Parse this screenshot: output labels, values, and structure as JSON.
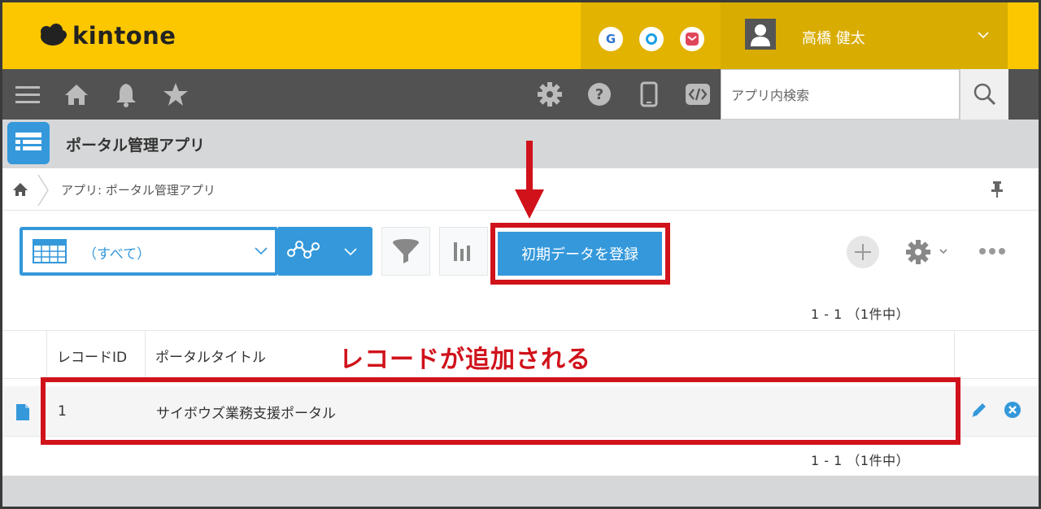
{
  "header": {
    "logo_text": "kintone",
    "services": [
      {
        "letter": "G",
        "color": "#3275d1"
      },
      {
        "letter": "O",
        "color": "#1aa0e6"
      },
      {
        "letter": "✉",
        "color": "#e0465a"
      }
    ],
    "user_name": "高橋 健太"
  },
  "nav": {
    "search_placeholder": "アプリ内検索"
  },
  "app": {
    "title": "ポータル管理アプリ"
  },
  "breadcrumb": {
    "text": "アプリ: ポータル管理アプリ"
  },
  "toolbar": {
    "view_label": "（すべて）",
    "register_label": "初期データを登録"
  },
  "pager": {
    "top": "1 - 1 （1件中）",
    "bottom": "1 - 1 （1件中）"
  },
  "table": {
    "columns": [
      "レコードID",
      "ポータルタイトル"
    ],
    "rows": [
      {
        "id": "1",
        "title": "サイボウズ業務支援ポータル"
      }
    ]
  },
  "annotation": {
    "text": "レコードが追加される",
    "color": "#d0121b"
  },
  "colors": {
    "brand_yellow": "#fdc700",
    "nav_dark": "#525252",
    "accent_blue": "#3498db",
    "highlight_red": "#d0121b"
  }
}
